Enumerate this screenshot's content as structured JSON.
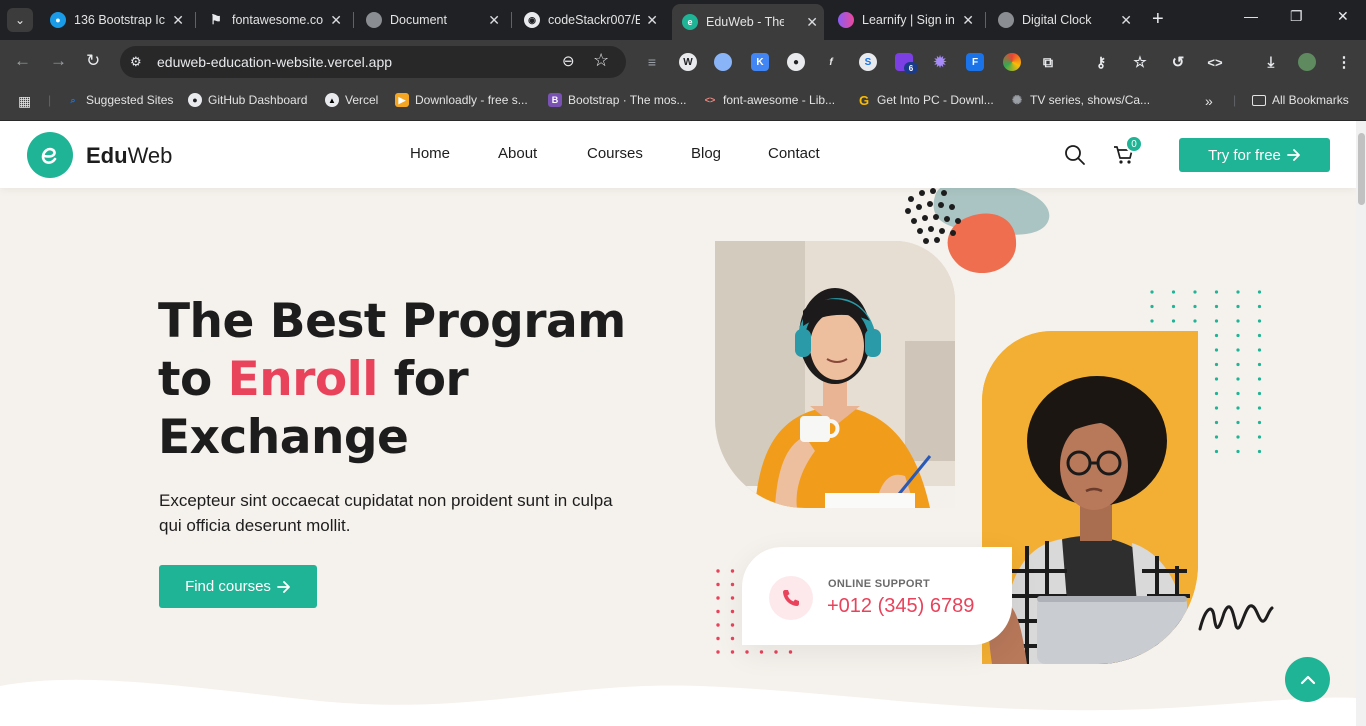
{
  "browser": {
    "tabs": [
      {
        "title": "136 Bootstrap Ic"
      },
      {
        "title": "fontawesome.co"
      },
      {
        "title": "Document"
      },
      {
        "title": "codeStackr007/E"
      },
      {
        "title": "EduWeb - The B"
      },
      {
        "title": "Learnify | Sign in"
      },
      {
        "title": "Digital Clock"
      }
    ],
    "url": "eduweb-education-website.vercel.app",
    "ext_badge": "6",
    "bookmarks": [
      {
        "label": "Suggested Sites"
      },
      {
        "label": "GitHub Dashboard"
      },
      {
        "label": "Vercel"
      },
      {
        "label": "Downloadly - free s..."
      },
      {
        "label": "Bootstrap · The mos..."
      },
      {
        "label": "font-awesome - Lib..."
      },
      {
        "label": "Get Into PC - Downl..."
      },
      {
        "label": "TV series, shows/Ca..."
      }
    ],
    "all_bookmarks": "All Bookmarks"
  },
  "site": {
    "logo_bold": "Edu",
    "logo_light": "Web",
    "nav": [
      "Home",
      "About",
      "Courses",
      "Blog",
      "Contact"
    ],
    "cart_count": "0",
    "try_label": "Try for free",
    "hero": {
      "title_line1": "The Best Program",
      "title_to": "to",
      "title_accent": "Enroll",
      "title_for": "for",
      "title_line3": "Exchange",
      "description": "Excepteur sint occaecat cupidatat non proident sunt in culpa qui officia deserunt mollit.",
      "button": "Find courses"
    },
    "support": {
      "label": "ONLINE SUPPORT",
      "phone": "+012 (345) 6789"
    }
  },
  "colors": {
    "brand": "#1fb496",
    "accent": "#e9435c",
    "background": "#f5f1ec"
  }
}
